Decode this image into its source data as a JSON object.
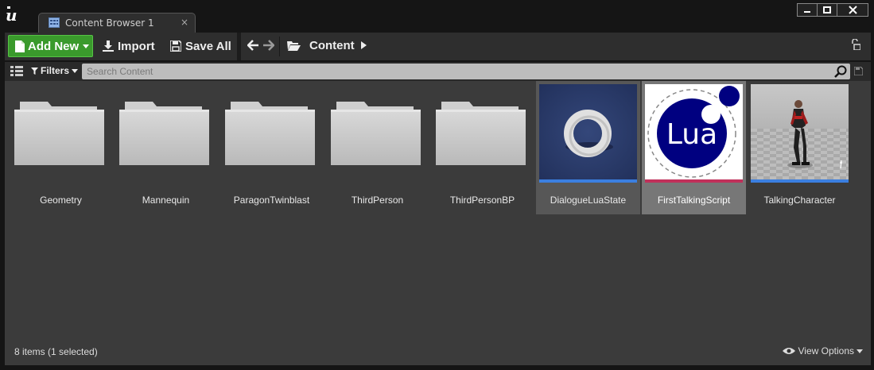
{
  "window": {
    "tab_label": "Content Browser 1",
    "tab_close": "×"
  },
  "toolbar": {
    "add_new_label": "Add New",
    "import_label": "Import",
    "save_all_label": "Save All",
    "path_root": "Content"
  },
  "filterbar": {
    "filters_label": "Filters",
    "search_placeholder": "Search Content"
  },
  "assets": [
    {
      "name": "Geometry",
      "type": "folder"
    },
    {
      "name": "Mannequin",
      "type": "folder"
    },
    {
      "name": "ParagonTwinblast",
      "type": "folder"
    },
    {
      "name": "ThirdPerson",
      "type": "folder"
    },
    {
      "name": "ThirdPersonBP",
      "type": "folder"
    },
    {
      "name": "DialogueLuaState",
      "type": "asset",
      "state": "hovered"
    },
    {
      "name": "FirstTalkingScript",
      "type": "asset",
      "state": "selected",
      "thumb_text": "Lua"
    },
    {
      "name": "TalkingCharacter",
      "type": "asset"
    }
  ],
  "status": {
    "items_text": "8 items (1 selected)",
    "view_options_label": "View Options"
  },
  "colors": {
    "accent_green": "#3a9a2c",
    "asset_underline_blue": "#3b7fe0",
    "lua_blue": "#000080",
    "lua_underline": "#c0305a"
  }
}
